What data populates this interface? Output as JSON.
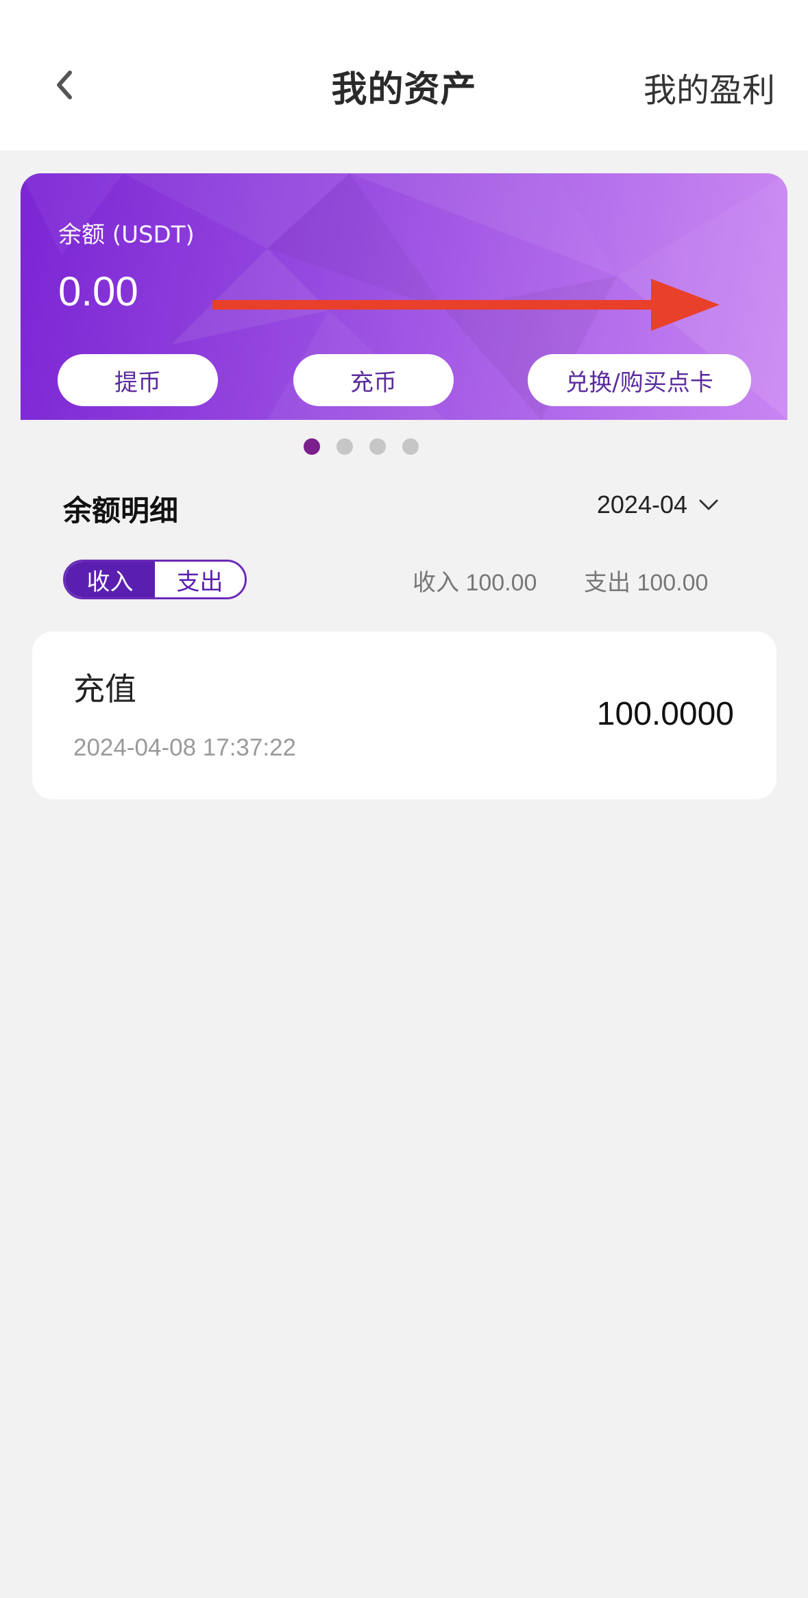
{
  "header": {
    "title": "我的资产",
    "right_link": "我的盈利",
    "back_icon": "chevron-left-icon"
  },
  "balance_card": {
    "label": "余额 (USDT)",
    "value": "0.00",
    "buttons": {
      "withdraw": "提币",
      "deposit": "充币",
      "exchange": "兑换/购买点卡"
    },
    "gradient_colors": [
      "#7b25d4",
      "#c985f2"
    ],
    "annotation_color": "#e8402a"
  },
  "carousel": {
    "count": 4,
    "active_index": 0,
    "active_color": "#7a1f8c"
  },
  "details": {
    "title": "余额明细",
    "month": "2024-04",
    "toggle": {
      "income": "收入",
      "expense": "支出",
      "selected": "income"
    },
    "summary_income": "收入 100.00",
    "summary_expense": "支出 100.00"
  },
  "records": [
    {
      "type": "充值",
      "time": "2024-04-08 17:37:22",
      "amount": "100.0000"
    }
  ],
  "colors": {
    "accent": "#5b1fb0",
    "background": "#f2f2f2"
  }
}
